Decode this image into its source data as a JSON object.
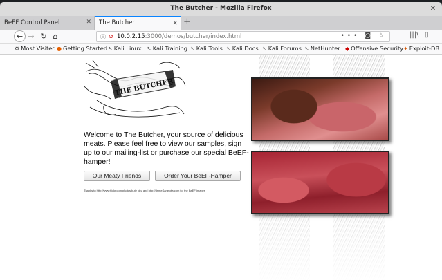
{
  "window": {
    "title": "The Butcher - Mozilla Firefox"
  },
  "tabs": [
    {
      "label": "BeEF Control Panel"
    },
    {
      "label": "The Butcher"
    }
  ],
  "urlbar": {
    "host": "10.0.2.15",
    "path": ":3000/demos/butcher/index.html"
  },
  "bookmarks": [
    {
      "label": "Most Visited",
      "icon": "gear-icon"
    },
    {
      "label": "Getting Started",
      "icon": "firefox-icon"
    },
    {
      "label": "Kali Linux",
      "icon": "kali-dragon-icon"
    },
    {
      "label": "Kali Training",
      "icon": "kali-dragon-icon"
    },
    {
      "label": "Kali Tools",
      "icon": "kali-dragon-icon"
    },
    {
      "label": "Kali Docs",
      "icon": "kali-dragon-icon"
    },
    {
      "label": "Kali Forums",
      "icon": "kali-dragon-icon"
    },
    {
      "label": "NetHunter",
      "icon": "kali-dragon-icon"
    },
    {
      "label": "Offensive Security",
      "icon": "offsec-icon"
    },
    {
      "label": "Exploit-DB",
      "icon": "exploitdb-icon"
    }
  ],
  "page": {
    "logo_text": "THE BUTCHER",
    "welcome": "Welcome to The Butcher, your source of delicious meats. Please feel free to view our samples, sign up to our mailing-list or purchase our special BeEF-hamper!",
    "button_friends": "Our Meaty Friends",
    "button_hamper": "Order Your BeEF-Hamper",
    "credit": "Thanks to http://www.flickr.com/photos/bute_db/ and http://drimeSarasota.com for the BeEF images"
  },
  "colors": {
    "tab_accent": "#0a84ff",
    "url_warning": "#cc0000"
  }
}
